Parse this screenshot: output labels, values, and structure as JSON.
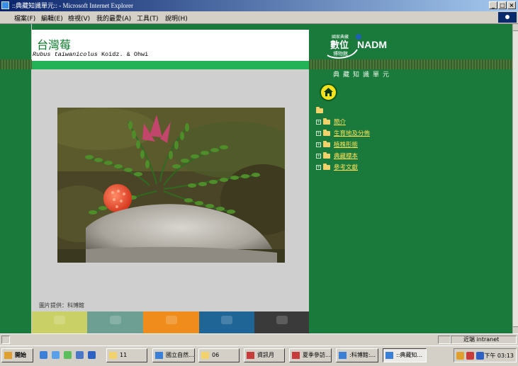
{
  "window": {
    "title": "::典藏知識單元:: - Microsoft Internet Explorer",
    "controls": [
      "_",
      "□",
      "×"
    ]
  },
  "menu": [
    "檔案(F)",
    "編輯(E)",
    "檢視(V)",
    "我的最愛(A)",
    "工具(T)",
    "說明(H)"
  ],
  "species": {
    "common_name": "台灣莓",
    "scientific_genus": "Rubus taiwanicolus",
    "scientific_authority": "Koidz. & Ohwi"
  },
  "photo_credit": "圖片提供：科博館",
  "tiles": [
    {
      "color": "#c9d166"
    },
    {
      "color": "#6d9f93"
    },
    {
      "color": "#f08c1c"
    },
    {
      "color": "#1f6596"
    },
    {
      "color": "#3a3a3a"
    }
  ],
  "brand": {
    "small": "國家典藏",
    "big": "數位",
    "sub_small": "博物館",
    "acronym": "NADM",
    "unit": "典藏知識單元"
  },
  "nav": {
    "home_icon": "home-icon",
    "items": [
      "簡介",
      "生育地及分佈",
      "植株形態",
      "典藏標本",
      "參考文獻"
    ]
  },
  "status": {
    "zone_label": "近端 intranet"
  },
  "taskbar": {
    "start": "開始",
    "buttons": [
      "11",
      "國立自然...",
      "06",
      "資訊月",
      "夏季參訪...",
      ":科博館:...",
      "::典藏知..."
    ],
    "clock": "下午 03:13"
  }
}
